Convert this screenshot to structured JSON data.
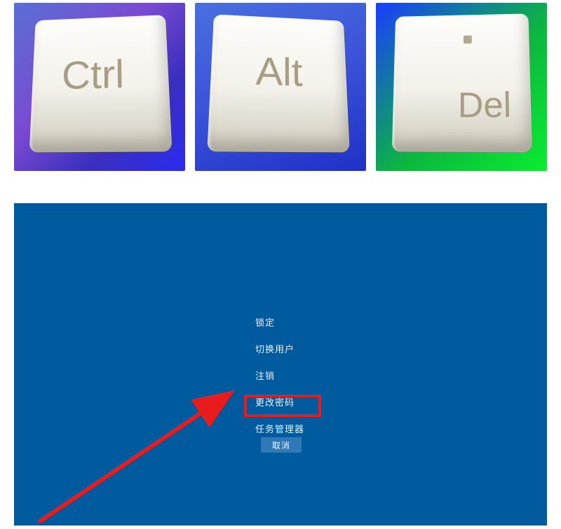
{
  "keys": {
    "ctrl": "Ctrl",
    "alt": "Alt",
    "del": "Del"
  },
  "lockMenu": {
    "lock": "锁定",
    "switchUser": "切换用户",
    "signOut": "注销",
    "changePassword": "更改密码",
    "taskManager": "任务管理器"
  },
  "cancel": "取消",
  "colors": {
    "lockBg": "#005a9e",
    "highlight": "#e81c1c"
  }
}
